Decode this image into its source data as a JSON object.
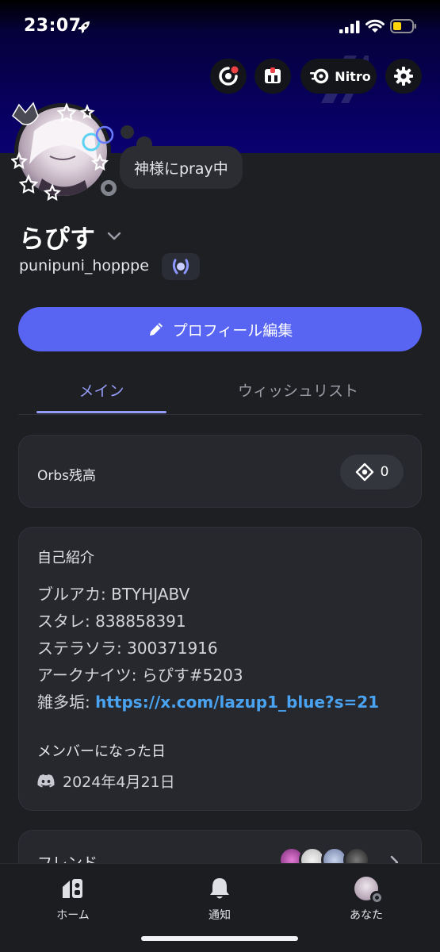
{
  "status_bar": {
    "time": "23:07"
  },
  "header": {
    "nitro_label": "Nitro"
  },
  "profile": {
    "status_text": "神様にpray中",
    "display_name": "らぴす",
    "username": "punipuni_hopppe",
    "edit_button_label": "プロフィール編集"
  },
  "tabs": [
    {
      "label": "メイン",
      "active": true
    },
    {
      "label": "ウィッシュリスト",
      "active": false
    }
  ],
  "orbs": {
    "label": "Orbs残高",
    "balance": "0"
  },
  "bio": {
    "title": "自己紹介",
    "lines": [
      "ブルアカ: BTYHJABV",
      "スタレ: 838858391",
      "ステラソラ: 300371916",
      "アークナイツ: らぴす#5203"
    ],
    "link_prefix": "雑多垢: ",
    "link_text": "https://x.com/lazup1_blue?s=21",
    "member_since_title": "メンバーになった日",
    "member_since_date": "2024年4月21日"
  },
  "friends": {
    "label": "フレンド"
  },
  "bottom_nav": {
    "home": "ホーム",
    "notifications": "通知",
    "you": "あなた"
  },
  "colors": {
    "accent": "#5865f2",
    "tab_active": "#949cf7",
    "link": "#4aa3f0",
    "banner": "#070059",
    "background": "#1e1f23"
  }
}
